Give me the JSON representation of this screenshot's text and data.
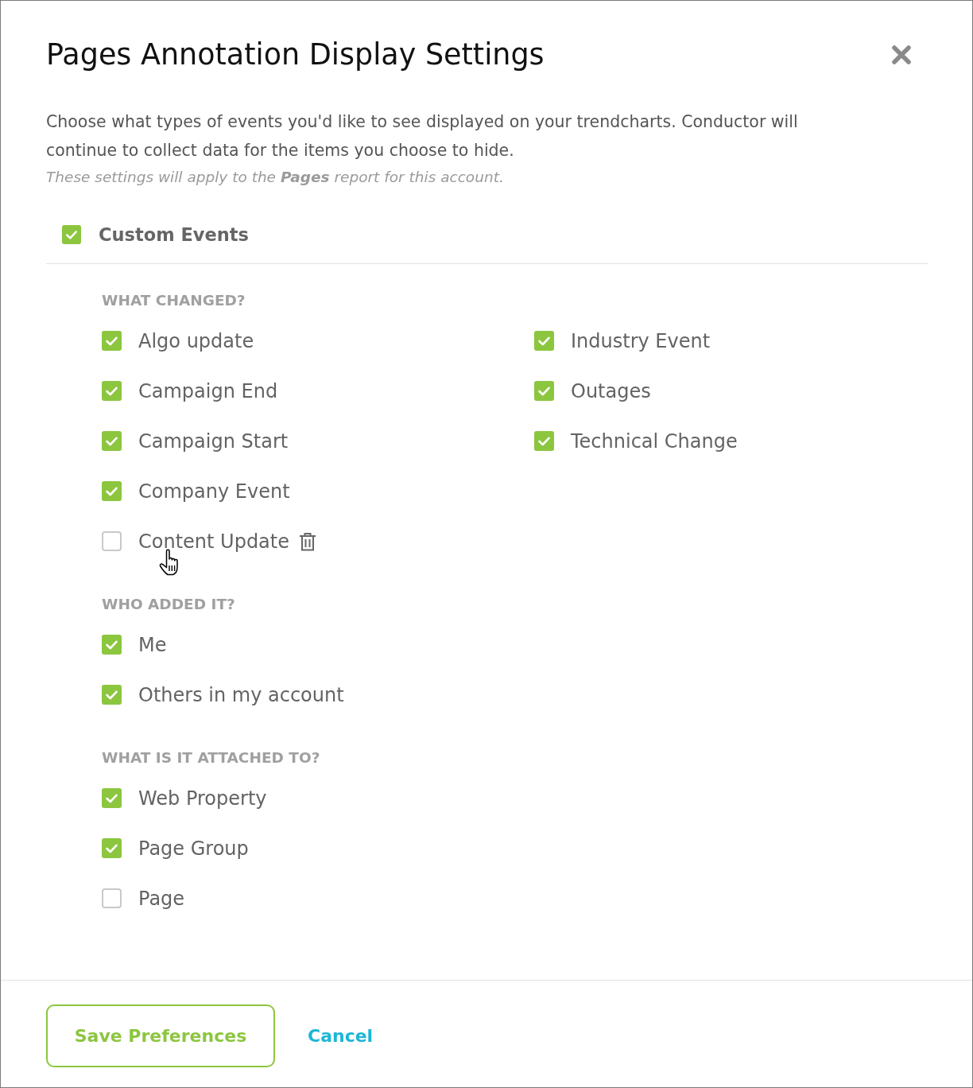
{
  "dialog": {
    "title": "Pages Annotation Display Settings"
  },
  "intro": {
    "description": "Choose what types of events you'd like to see displayed on your trendcharts. Conductor will continue to collect data for the items you choose to hide.",
    "note": "These settings will apply to the **Pages** report for this account."
  },
  "master": {
    "label": "Custom Events",
    "checked": true
  },
  "groups": [
    {
      "heading": "WHAT CHANGED?",
      "columns": [
        {
          "items": [
            {
              "label": "Algo update",
              "checked": true,
              "hovered": false
            },
            {
              "label": "Campaign End",
              "checked": true,
              "hovered": false
            },
            {
              "label": "Campaign Start",
              "checked": true,
              "hovered": false
            },
            {
              "label": "Company Event",
              "checked": true,
              "hovered": false
            },
            {
              "label": "Content Update",
              "checked": false,
              "hovered": true
            }
          ]
        },
        {
          "items": [
            {
              "label": "Industry Event",
              "checked": true,
              "hovered": false
            },
            {
              "label": "Outages",
              "checked": true,
              "hovered": false
            },
            {
              "label": "Technical Change",
              "checked": true,
              "hovered": false
            }
          ]
        }
      ]
    },
    {
      "heading": "WHO ADDED IT?",
      "columns": [
        {
          "items": [
            {
              "label": "Me",
              "checked": true,
              "hovered": false
            },
            {
              "label": "Others in my account",
              "checked": true,
              "hovered": false
            }
          ]
        }
      ]
    },
    {
      "heading": "WHAT IS IT ATTACHED TO?",
      "columns": [
        {
          "items": [
            {
              "label": "Web Property",
              "checked": true,
              "hovered": false
            },
            {
              "label": "Page Group",
              "checked": true,
              "hovered": false
            },
            {
              "label": "Page",
              "checked": false,
              "hovered": false
            }
          ]
        }
      ]
    }
  ],
  "footer": {
    "buttons": [
      {
        "kind": "primary",
        "label": "Save Preferences"
      },
      {
        "kind": "link",
        "label": "Cancel"
      }
    ]
  }
}
